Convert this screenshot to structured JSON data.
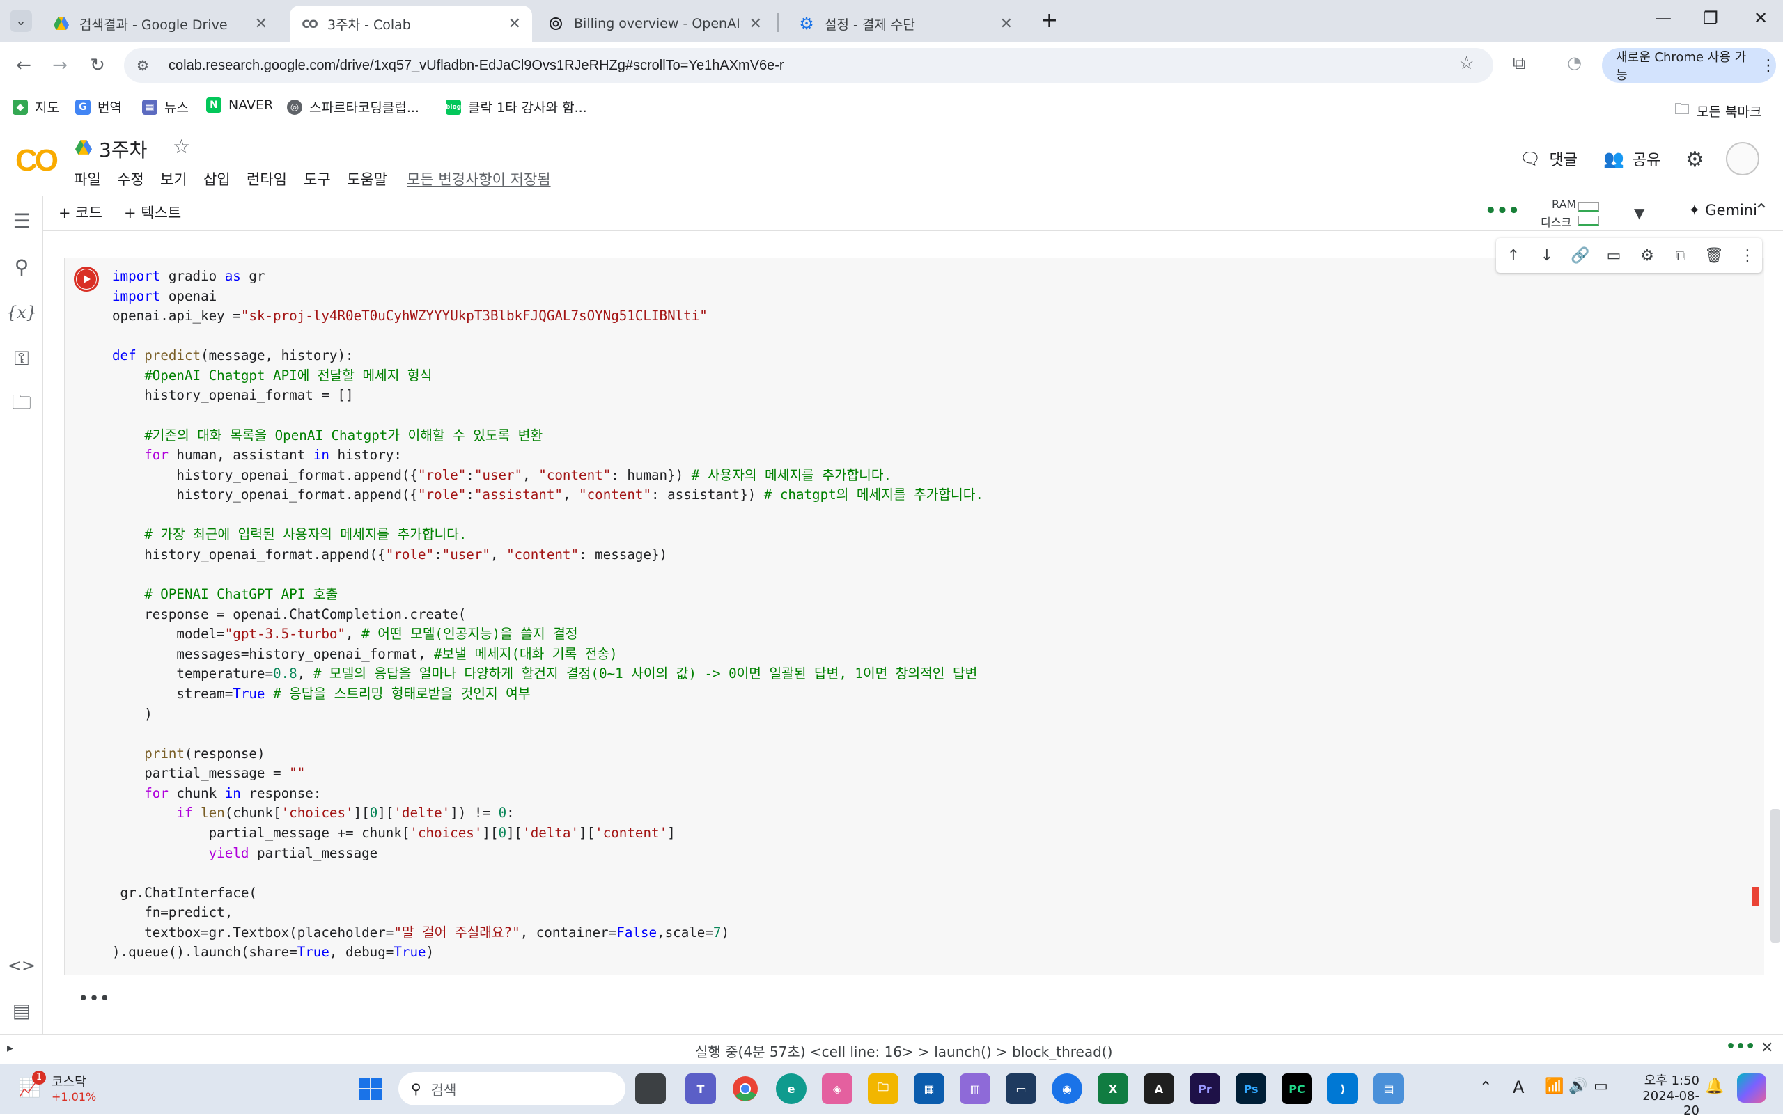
{
  "browser": {
    "tabs": [
      {
        "title": "검색결과 - Google Drive",
        "icon": "google-drive-icon"
      },
      {
        "title": "3주차 - Colab",
        "icon": "colab-icon",
        "active": true
      },
      {
        "title": "Billing overview - OpenAI API",
        "icon": "openai-icon"
      },
      {
        "title": "설정 - 결제 수단",
        "icon": "settings-gear-icon"
      }
    ],
    "url": "colab.research.google.com/drive/1xq57_vUfladbn-EdJaCl9Ovs1RJeRHZg#scrollTo=Ye1hAXmV6e-r",
    "chrome_promo": "새로운 Chrome 사용 가능",
    "bookmarks": [
      {
        "label": "지도",
        "color": "#34a853"
      },
      {
        "label": "번역",
        "color": "#4285f4"
      },
      {
        "label": "뉴스",
        "color": "#5c6bc0"
      },
      {
        "label": "NAVER",
        "color": "#03c75a",
        "glyph": "N"
      },
      {
        "label": "스파르타코딩클럽...",
        "color": "#5f6368"
      },
      {
        "label": "클락 1타 강사와 함...",
        "color": "#03c75a"
      }
    ],
    "all_bookmarks": "모든 북마크"
  },
  "colab": {
    "logo": "CO",
    "notebook_title": "3주차",
    "menu": [
      "파일",
      "수정",
      "보기",
      "삽입",
      "런타임",
      "도구",
      "도움말"
    ],
    "save_status": "모든 변경사항이 저장됨",
    "comment_label": "댓글",
    "share_label": "공유",
    "add_code": "+ 코드",
    "add_text": "+ 텍스트",
    "ram_label": "RAM",
    "disk_label": "디스크",
    "gemini_label": "Gemini"
  },
  "code_lines": [
    {
      "segs": [
        [
          "import",
          "kw"
        ],
        [
          " gradio ",
          ""
        ],
        [
          "as",
          "kw"
        ],
        [
          " gr",
          ""
        ]
      ]
    },
    {
      "segs": [
        [
          "import",
          "kw"
        ],
        [
          " openai",
          ""
        ]
      ]
    },
    {
      "segs": [
        [
          "openai.api_key =",
          ""
        ],
        [
          "\"sk-proj-ly4R0eT0uCyhWZYYYUkpT3BlbkFJQGAL7sOYNg51CLIBNlti\"",
          "str"
        ]
      ]
    },
    {
      "segs": [
        [
          "",
          ""
        ]
      ]
    },
    {
      "segs": [
        [
          "def",
          "kw"
        ],
        [
          " ",
          ""
        ],
        [
          "predict",
          "fn"
        ],
        [
          "(message, history):",
          ""
        ]
      ]
    },
    {
      "segs": [
        [
          "    #OpenAI Chatgpt API에 전달할 메세지 형식",
          "cm"
        ]
      ]
    },
    {
      "segs": [
        [
          "    history_openai_format = []",
          ""
        ]
      ]
    },
    {
      "segs": [
        [
          "",
          ""
        ]
      ]
    },
    {
      "segs": [
        [
          "    #기존의 대화 목록을 OpenAI Chatgpt가 이해할 수 있도록 변환",
          "cm"
        ]
      ]
    },
    {
      "segs": [
        [
          "    ",
          ""
        ],
        [
          "for",
          "ctrl"
        ],
        [
          " human, assistant ",
          ""
        ],
        [
          "in",
          "kw"
        ],
        [
          " history:",
          ""
        ]
      ]
    },
    {
      "segs": [
        [
          "        history_openai_format.append({",
          ""
        ],
        [
          "\"role\"",
          "str"
        ],
        [
          ":",
          ""
        ],
        [
          "\"user\"",
          "str"
        ],
        [
          ", ",
          ""
        ],
        [
          "\"content\"",
          "str"
        ],
        [
          ": human}) ",
          ""
        ],
        [
          "# 사용자의 메세지를 추가합니다.",
          "cm"
        ]
      ]
    },
    {
      "segs": [
        [
          "        history_openai_format.append({",
          ""
        ],
        [
          "\"role\"",
          "str"
        ],
        [
          ":",
          ""
        ],
        [
          "\"assistant\"",
          "str"
        ],
        [
          ", ",
          ""
        ],
        [
          "\"content\"",
          "str"
        ],
        [
          ": assistant}) ",
          ""
        ],
        [
          "# chatgpt의 메세지를 추가합니다.",
          "cm"
        ]
      ]
    },
    {
      "segs": [
        [
          "",
          ""
        ]
      ]
    },
    {
      "segs": [
        [
          "    # 가장 최근에 입력된 사용자의 메세지를 추가합니다.",
          "cm"
        ]
      ]
    },
    {
      "segs": [
        [
          "    history_openai_format.append({",
          ""
        ],
        [
          "\"role\"",
          "str"
        ],
        [
          ":",
          ""
        ],
        [
          "\"user\"",
          "str"
        ],
        [
          ", ",
          ""
        ],
        [
          "\"content\"",
          "str"
        ],
        [
          ": message})",
          ""
        ]
      ]
    },
    {
      "segs": [
        [
          "",
          ""
        ]
      ]
    },
    {
      "segs": [
        [
          "    # OPENAI ChatGPT API 호출",
          "cm"
        ]
      ]
    },
    {
      "segs": [
        [
          "    response = openai.ChatCompletion.create(",
          ""
        ]
      ]
    },
    {
      "segs": [
        [
          "        model=",
          ""
        ],
        [
          "\"gpt-3.5-turbo\"",
          "str"
        ],
        [
          ", ",
          ""
        ],
        [
          "# 어떤 모델(인공지능)을 쓸지 결정",
          "cm"
        ]
      ]
    },
    {
      "segs": [
        [
          "        messages=history_openai_format, ",
          ""
        ],
        [
          "#보낼 메세지(대화 기록 전송)",
          "cm"
        ]
      ]
    },
    {
      "segs": [
        [
          "        temperature=",
          ""
        ],
        [
          "0.8",
          "num"
        ],
        [
          ", ",
          ""
        ],
        [
          "# 모델의 응답을 얼마나 다양하게 할건지 결정(0~1 사이의 값) -> 0이면 일괄된 답변, 1이면 창의적인 답변",
          "cm"
        ]
      ]
    },
    {
      "segs": [
        [
          "        stream=",
          ""
        ],
        [
          "True",
          "kw"
        ],
        [
          " ",
          ""
        ],
        [
          "# 응답을 스트리밍 형태로받을 것인지 여부",
          "cm"
        ]
      ]
    },
    {
      "segs": [
        [
          "    )",
          ""
        ]
      ]
    },
    {
      "segs": [
        [
          "",
          ""
        ]
      ]
    },
    {
      "segs": [
        [
          "    ",
          ""
        ],
        [
          "print",
          "fn"
        ],
        [
          "(response)",
          ""
        ]
      ]
    },
    {
      "segs": [
        [
          "    partial_message = ",
          ""
        ],
        [
          "\"\"",
          "str"
        ]
      ]
    },
    {
      "segs": [
        [
          "    ",
          ""
        ],
        [
          "for",
          "ctrl"
        ],
        [
          " chunk ",
          ""
        ],
        [
          "in",
          "kw"
        ],
        [
          " response:",
          ""
        ]
      ]
    },
    {
      "segs": [
        [
          "        ",
          ""
        ],
        [
          "if",
          "ctrl"
        ],
        [
          " ",
          ""
        ],
        [
          "len",
          "fn"
        ],
        [
          "(chunk[",
          ""
        ],
        [
          "'choices'",
          "str"
        ],
        [
          "][",
          ""
        ],
        [
          "0",
          "num"
        ],
        [
          "][",
          ""
        ],
        [
          "'delte'",
          "str"
        ],
        [
          "]) != ",
          ""
        ],
        [
          "0",
          "num"
        ],
        [
          ":",
          ""
        ]
      ]
    },
    {
      "segs": [
        [
          "            partial_message += chunk[",
          ""
        ],
        [
          "'choices'",
          "str"
        ],
        [
          "][",
          ""
        ],
        [
          "0",
          "num"
        ],
        [
          "][",
          ""
        ],
        [
          "'delta'",
          "str"
        ],
        [
          "][",
          ""
        ],
        [
          "'content'",
          "str"
        ],
        [
          "]",
          ""
        ]
      ]
    },
    {
      "segs": [
        [
          "            ",
          ""
        ],
        [
          "yield",
          "ctrl"
        ],
        [
          " partial_message",
          ""
        ]
      ]
    },
    {
      "segs": [
        [
          "",
          ""
        ]
      ]
    },
    {
      "segs": [
        [
          " gr.ChatInterface(",
          ""
        ]
      ]
    },
    {
      "segs": [
        [
          "    fn=predict,",
          ""
        ]
      ]
    },
    {
      "segs": [
        [
          "    textbox=gr.Textbox(placeholder=",
          ""
        ],
        [
          "\"말 걸어 주실래요?\"",
          "str"
        ],
        [
          ", container=",
          ""
        ],
        [
          "False",
          "kw"
        ],
        [
          ",scale=",
          ""
        ],
        [
          "7",
          "num"
        ],
        [
          ")",
          ""
        ]
      ]
    },
    {
      "segs": [
        [
          ").queue().launch(share=",
          ""
        ],
        [
          "True",
          "kw"
        ],
        [
          ", debug=",
          ""
        ],
        [
          "True",
          "kw"
        ],
        [
          ")",
          ""
        ]
      ]
    }
  ],
  "status": {
    "text": "실행 중(4분 57초)  <cell line: 16> > launch() > block_thread()"
  },
  "taskbar": {
    "stock_name": "코스닥",
    "stock_change": "+1.01%",
    "stock_badge": "1",
    "search_placeholder": "검색",
    "time": "오후 1:50",
    "date": "2024-08-20"
  },
  "colors": {
    "colab_orange": "#f9ab00",
    "run_red": "#d93025",
    "accent_blue": "#1a73e8"
  }
}
